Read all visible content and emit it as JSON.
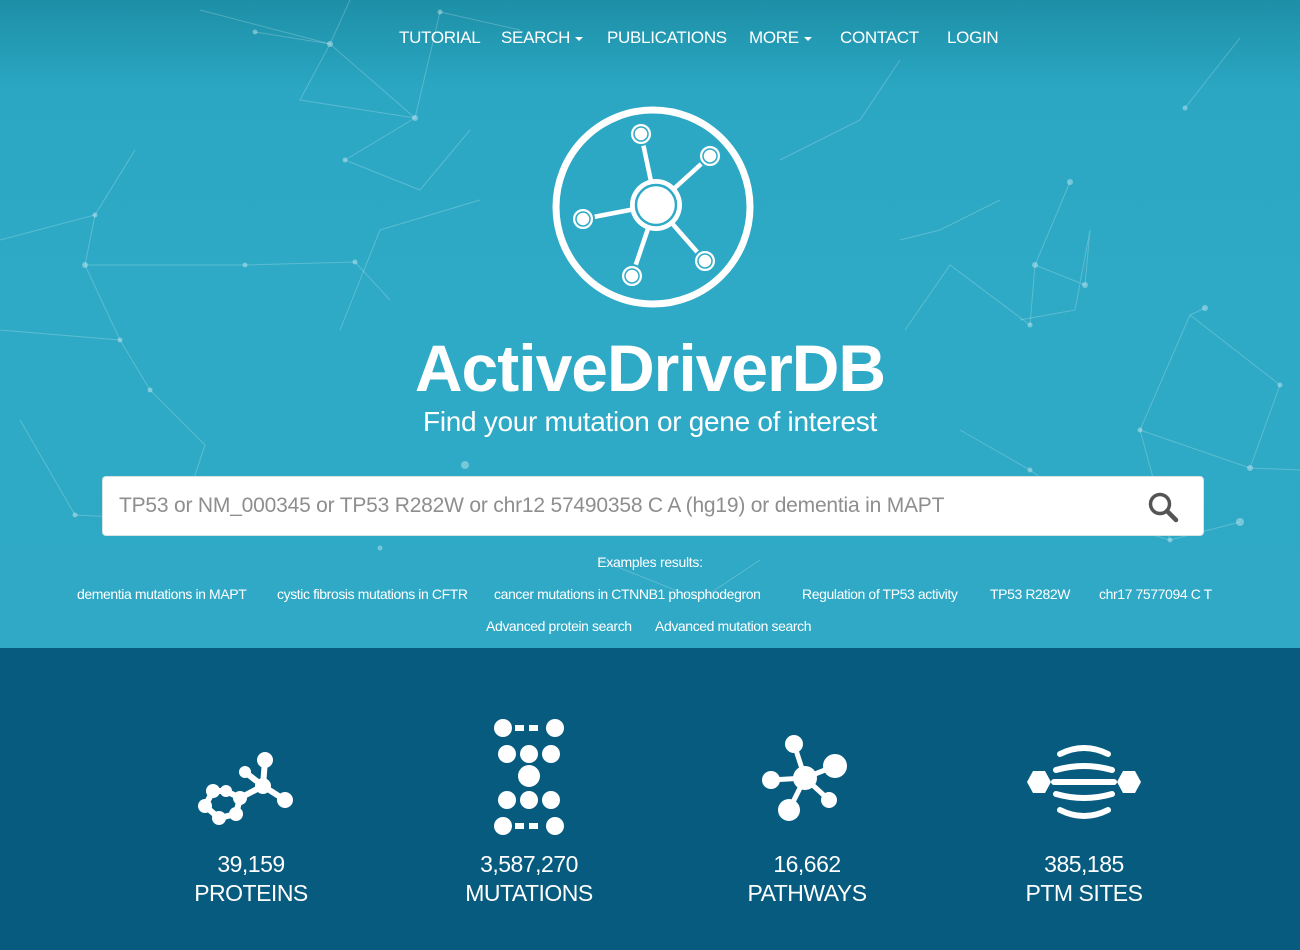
{
  "nav": {
    "items": [
      {
        "label": "TUTORIAL",
        "dropdown": false
      },
      {
        "label": "SEARCH",
        "dropdown": true
      },
      {
        "label": "PUBLICATIONS",
        "dropdown": false
      },
      {
        "label": "MORE",
        "dropdown": true
      },
      {
        "label": "CONTACT",
        "dropdown": false
      },
      {
        "label": "LOGIN",
        "dropdown": false
      }
    ]
  },
  "hero": {
    "title": "ActiveDriverDB",
    "subtitle": "Find your mutation or gene of interest",
    "logo_icon": "network-node-logo"
  },
  "search": {
    "placeholder": "TP53 or NM_000345 or TP53 R282W or chr12 57490358 C A (hg19) or dementia in MAPT",
    "value": "",
    "icon": "search-icon"
  },
  "examples": {
    "label": "Examples results:",
    "links": [
      "dementia mutations in MAPT",
      "cystic fibrosis mutations in CFTR",
      "cancer mutations in CTNNB1 phosphodegron",
      "Regulation of TP53 activity",
      "TP53 R282W",
      "chr17 7577094 C T"
    ],
    "advanced": [
      "Advanced protein search",
      "Advanced mutation search"
    ]
  },
  "stats": [
    {
      "value": "39,159",
      "label": "PROTEINS",
      "icon": "molecule-icon"
    },
    {
      "value": "3,587,270",
      "label": "MUTATIONS",
      "icon": "dna-icon"
    },
    {
      "value": "16,662",
      "label": "PATHWAYS",
      "icon": "network-icon"
    },
    {
      "value": "385,185",
      "label": "PTM SITES",
      "icon": "protein-icon"
    }
  ],
  "colors": {
    "hero_bg": "#2eaac6",
    "stats_bg": "#065b7e",
    "text": "#ffffff"
  }
}
